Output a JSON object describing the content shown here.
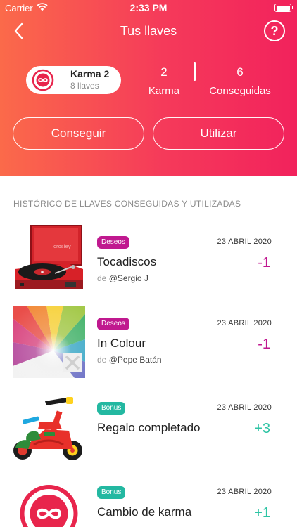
{
  "status_bar": {
    "carrier": "Carrier",
    "time": "2:33 PM"
  },
  "nav": {
    "title": "Tus llaves",
    "help_label": "?"
  },
  "karma": {
    "name": "Karma 2",
    "keys": "8 llaves"
  },
  "stats": [
    {
      "value": "2",
      "label": "Karma"
    },
    {
      "value": "6",
      "label": "Conseguidas"
    }
  ],
  "actions": {
    "get_label": "Conseguir",
    "use_label": "Utilizar"
  },
  "history": {
    "title": "HISTÓRICO DE LLAVES CONSEGUIDAS Y UTILIZADAS",
    "entries": [
      {
        "badge": "Deseos",
        "date": "23 ABRIL 2020",
        "name": "Tocadiscos",
        "by_prefix": "de",
        "by_user": "@Sergio J",
        "delta": "-1",
        "image": "record-player"
      },
      {
        "badge": "Deseos",
        "date": "23 ABRIL 2020",
        "name": "In Colour",
        "by_prefix": "de",
        "by_user": "@Pepe Batán",
        "delta": "-1",
        "image": "album-cover"
      },
      {
        "badge": "Bonus",
        "date": "23 ABRIL 2020",
        "name": "Regalo completado",
        "delta": "+3",
        "image": "tricycle"
      },
      {
        "badge": "Bonus",
        "date": "23 ABRIL 2020",
        "name": "Cambio de karma",
        "delta": "+1",
        "image": "karma-logo"
      }
    ]
  },
  "colors": {
    "header_start": "#fb6a4a",
    "header_end": "#f2225c",
    "deseos": "#c0198f",
    "bonus": "#23b8a1",
    "negative": "#c01990",
    "positive": "#2ec4a4"
  }
}
